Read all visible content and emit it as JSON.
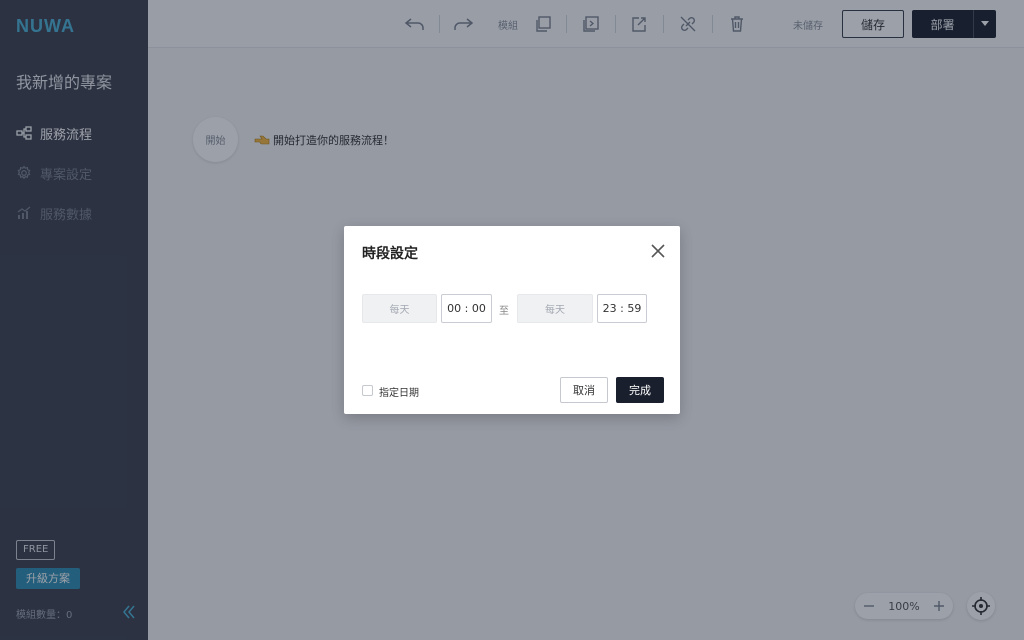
{
  "brand": {
    "logo_text": "NUWA"
  },
  "sidebar": {
    "project_title": "我新增的專案",
    "items": [
      {
        "label": "服務流程",
        "icon": "flow-icon",
        "active": true
      },
      {
        "label": "專案設定",
        "icon": "gear-icon",
        "active": false
      },
      {
        "label": "服務數據",
        "icon": "chart-icon",
        "active": false
      }
    ],
    "plan_badge": "FREE",
    "upgrade_label": "升級方案",
    "module_count": "模組數量：0"
  },
  "toolbar": {
    "module_label": "模組",
    "unsaved_label": "未儲存",
    "save_label": "儲存",
    "deploy_label": "部署"
  },
  "canvas": {
    "start_node_label": "開始",
    "start_hint": "開始打造你的服務流程！"
  },
  "zoom": {
    "value": "100%"
  },
  "modal": {
    "title": "時段設定",
    "start_day": "每天",
    "start_time": "00 : 00",
    "to_label": "至",
    "end_day": "每天",
    "end_time": "23 : 59",
    "specify_date_label": "指定日期",
    "cancel_label": "取消",
    "done_label": "完成"
  },
  "colors": {
    "sidebar_bg": "#3e4350",
    "brand_accent": "#4fb4d8",
    "primary_dark": "#1d2230",
    "upgrade_bg": "#2f8fb5"
  }
}
